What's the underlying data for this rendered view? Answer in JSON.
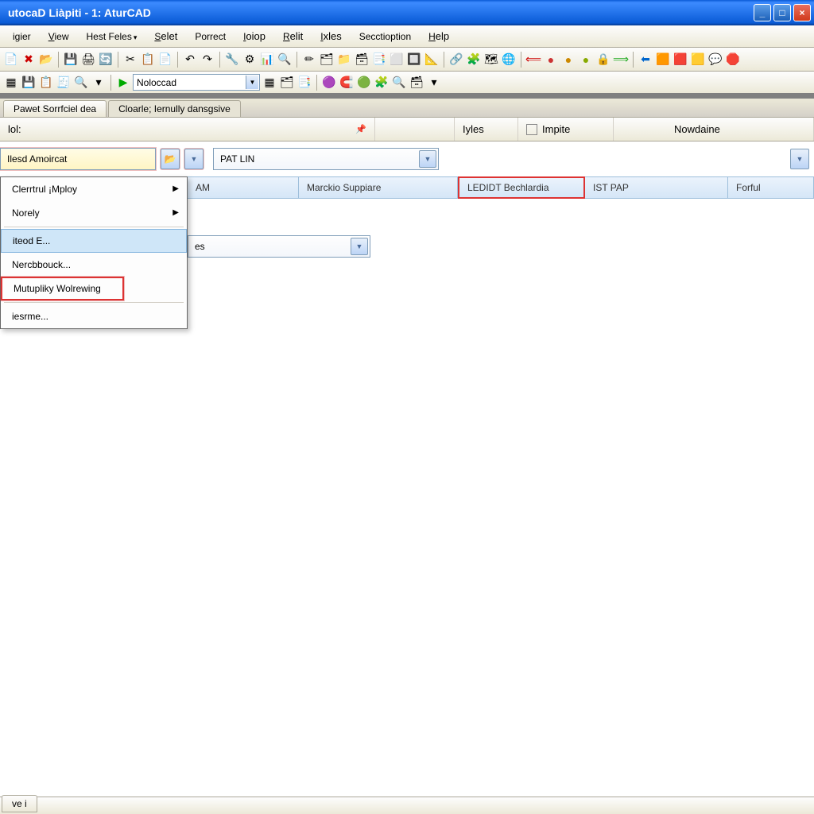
{
  "title": "utocaD Liàpiti - 1: AturCAD",
  "menu": [
    "igier",
    "View",
    "Hest Feles",
    "Selet",
    "Porrect",
    "Ioiop",
    "Relit",
    "Ixles",
    "Secctioption",
    "Help"
  ],
  "menu_with_arrow_index": 2,
  "toolbar2": {
    "combo_value": "Noloccad"
  },
  "tabs": {
    "t1": "Pawet Sorrfciel dea",
    "t2": "Cloarle; Iernully dansgsive"
  },
  "filter": {
    "left_label": "lol:",
    "iyles": "Iyles",
    "impite": "Impite",
    "nowdaine": "Nowdaine"
  },
  "combo_row": {
    "left_label": "Ilesd Amoircat",
    "right_label": "PAT LIN"
  },
  "columns": {
    "c1": "AM",
    "c2": "Marckio Suppiare",
    "c3": "LEDIDT Bechlardia",
    "c4": "IST PAP",
    "c5": "Forful"
  },
  "secondary_combo": "es",
  "menu_popup": {
    "m1": "Clerrtrul ¡Mploy",
    "m2": "Norely",
    "m3": "iteod E...",
    "m4": "Nercbbouck...",
    "m5": "Mutupliky Wolrewing",
    "m6": "iesrme..."
  },
  "bottom_tab": "ve i"
}
